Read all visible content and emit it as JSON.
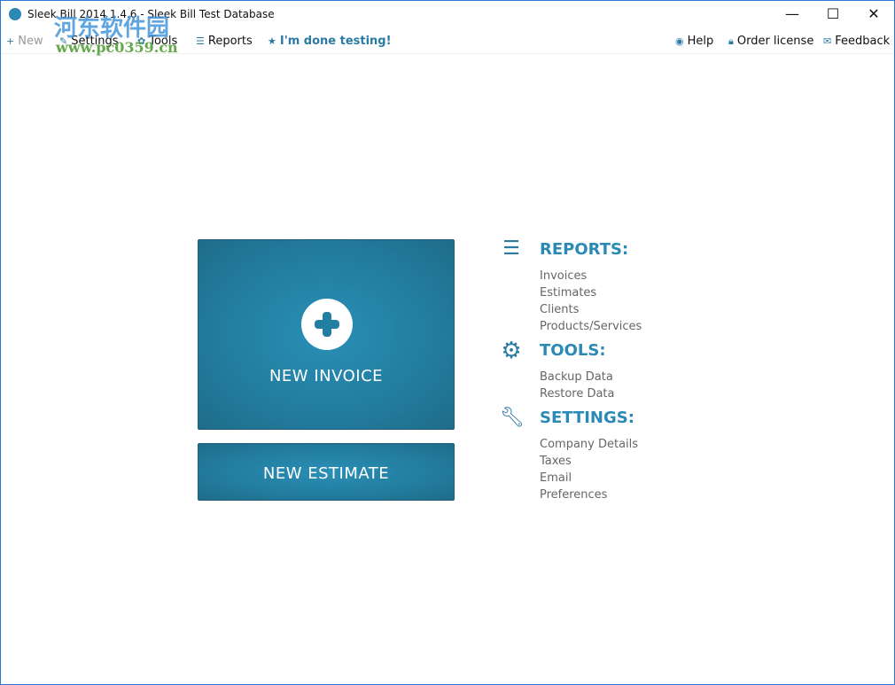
{
  "window": {
    "title": "Sleek Bill 2014 1.4.6 - Sleek Bill Test Database",
    "minimize": "—",
    "maximize": "☐",
    "close": "✕"
  },
  "menu": {
    "new": "New",
    "settings": "Settings",
    "tools": "Tools",
    "reports": "Reports",
    "done": "I'm done testing!",
    "help": "Help",
    "order": "Order license",
    "feedback": "Feedback"
  },
  "tiles": {
    "invoice": "NEW INVOICE",
    "estimate": "NEW ESTIMATE"
  },
  "reports": {
    "title": "REPORTS:",
    "items": [
      "Invoices",
      "Estimates",
      "Clients",
      "Products/Services"
    ]
  },
  "tools": {
    "title": "TOOLS:",
    "items": [
      "Backup Data",
      "Restore Data"
    ]
  },
  "settings": {
    "title": "SETTINGS:",
    "items": [
      "Company Details",
      "Taxes",
      "Email",
      "Preferences"
    ]
  },
  "watermark": {
    "line1": "河东软件园",
    "line2": "www.pc0359.cn"
  },
  "colors": {
    "accent": "#2a8ab5",
    "tile": "#227c9e"
  }
}
